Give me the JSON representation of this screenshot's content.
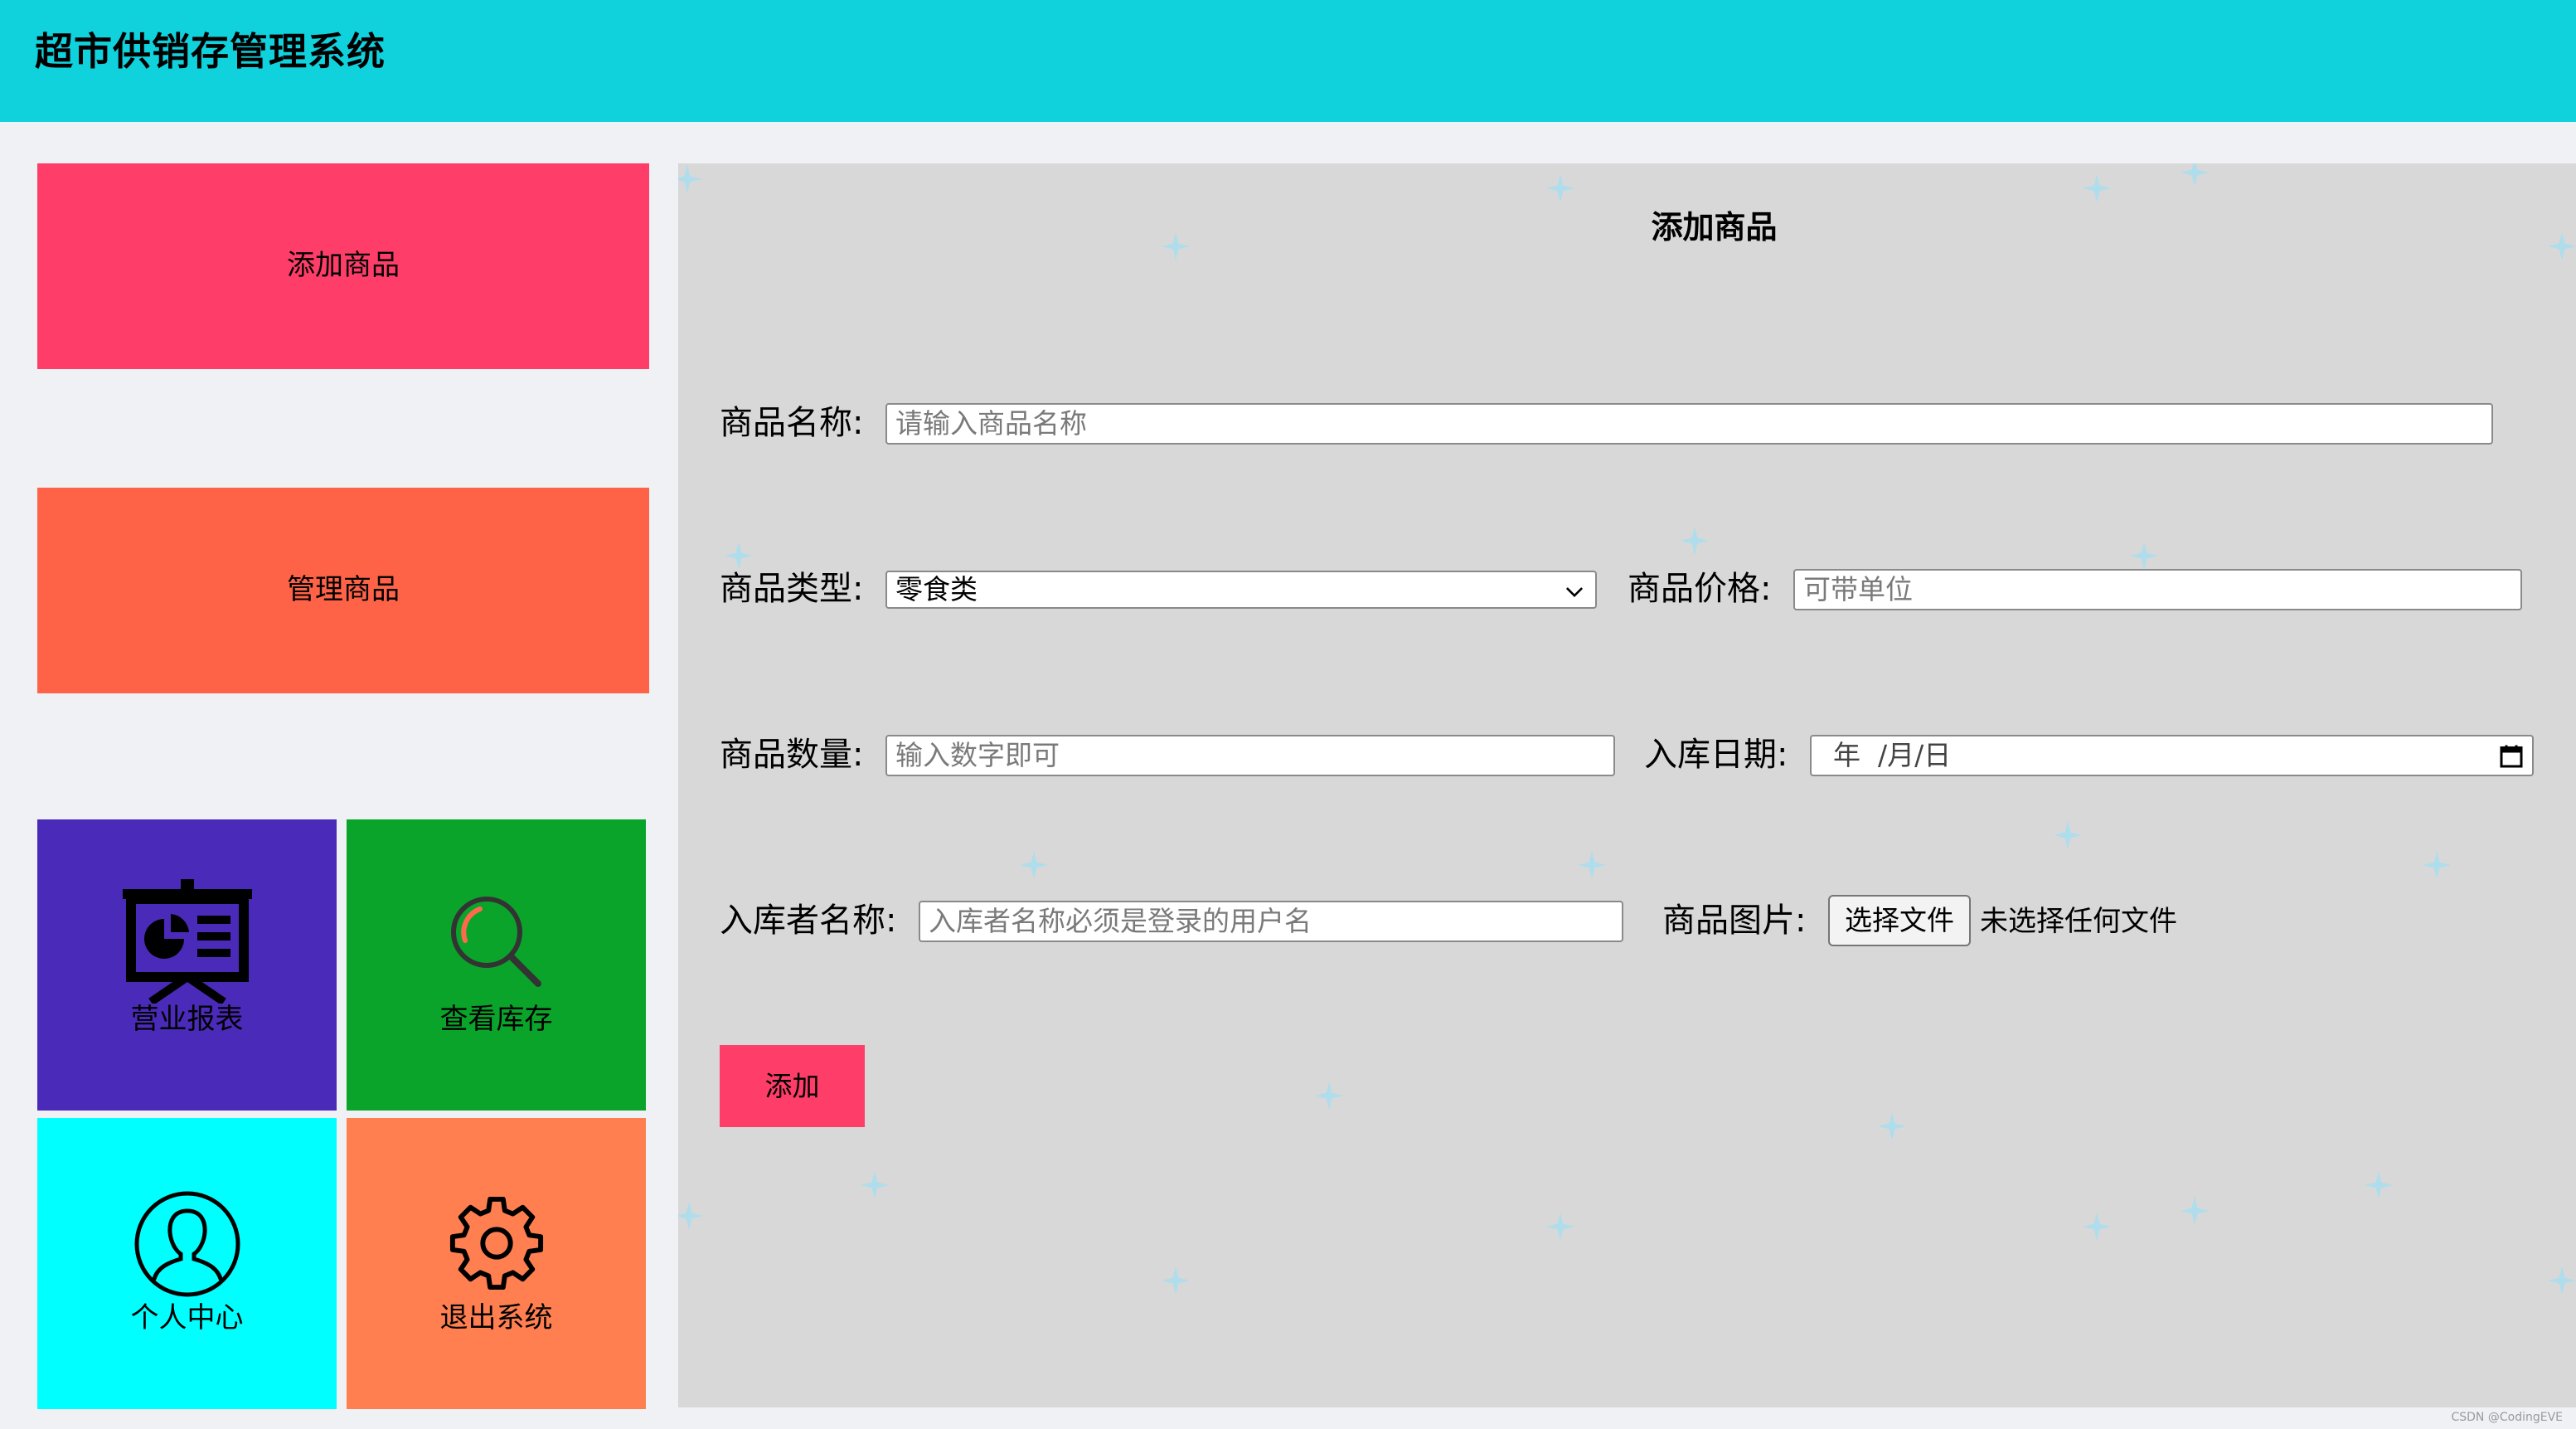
{
  "app": {
    "title": "超市供销存管理系统"
  },
  "sidebar": {
    "add_product": {
      "label": "添加商品",
      "color": "#fe3d69"
    },
    "manage_product": {
      "label": "管理商品",
      "color": "#ff6347"
    },
    "tiles": [
      {
        "label": "营业报表",
        "icon": "presentation-chart-icon",
        "color": "#4a2ab8"
      },
      {
        "label": "查看库存",
        "icon": "magnifier-icon",
        "color": "#0aa42b"
      },
      {
        "label": "个人中心",
        "icon": "user-circle-icon",
        "color": "#00ffff"
      },
      {
        "label": "退出系统",
        "icon": "gear-icon",
        "color": "#ff7f50"
      }
    ]
  },
  "form": {
    "title": "添加商品",
    "name": {
      "label": "商品名称:",
      "placeholder": "请输入商品名称"
    },
    "type": {
      "label": "商品类型:",
      "value": "零食类"
    },
    "price": {
      "label": "商品价格:",
      "placeholder": "可带单位"
    },
    "quantity": {
      "label": "商品数量:",
      "placeholder": "输入数字即可"
    },
    "date": {
      "label": "入库日期:",
      "year": "年",
      "month": "月",
      "day": "日"
    },
    "operator": {
      "label": "入库者名称:",
      "placeholder": "入库者名称必须是登录的用户名"
    },
    "image": {
      "label": "商品图片:",
      "button": "选择文件",
      "status": "未选择任何文件"
    },
    "submit": {
      "label": "添加",
      "color": "#fe3d69"
    }
  },
  "footer": {
    "watermark": "CSDN @CodingEVE"
  },
  "theme": {
    "header": "#10d2dd",
    "panel": "#d8d8d8",
    "sparkle": "#a8dff0"
  }
}
